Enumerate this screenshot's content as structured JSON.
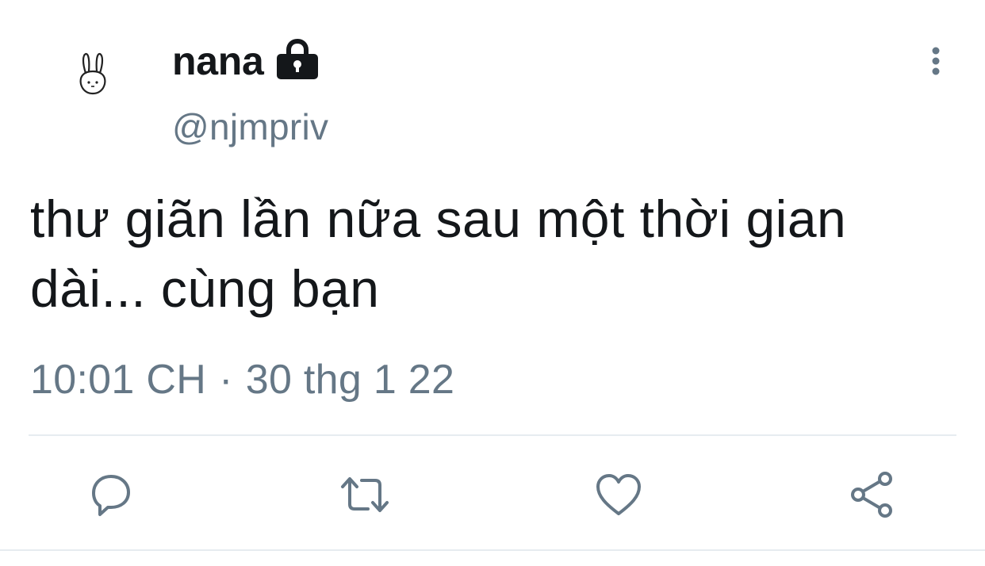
{
  "author": {
    "display_name": "nana",
    "handle": "@njmpriv",
    "avatar_icon": "bunny-icon",
    "protected_icon": "lock-icon"
  },
  "tweet": {
    "text": "thư giãn lần nữa sau một thời gian dài... cùng bạn",
    "time": "10:01 CH",
    "separator": "·",
    "date": "30 thg 1 22"
  },
  "actions": [
    {
      "name": "reply",
      "icon": "reply-icon"
    },
    {
      "name": "retweet",
      "icon": "retweet-icon"
    },
    {
      "name": "like",
      "icon": "heart-icon"
    },
    {
      "name": "share",
      "icon": "share-icon"
    }
  ],
  "colors": {
    "text_primary": "#14171a",
    "text_secondary": "#657786",
    "divider": "#e6ecf0"
  }
}
